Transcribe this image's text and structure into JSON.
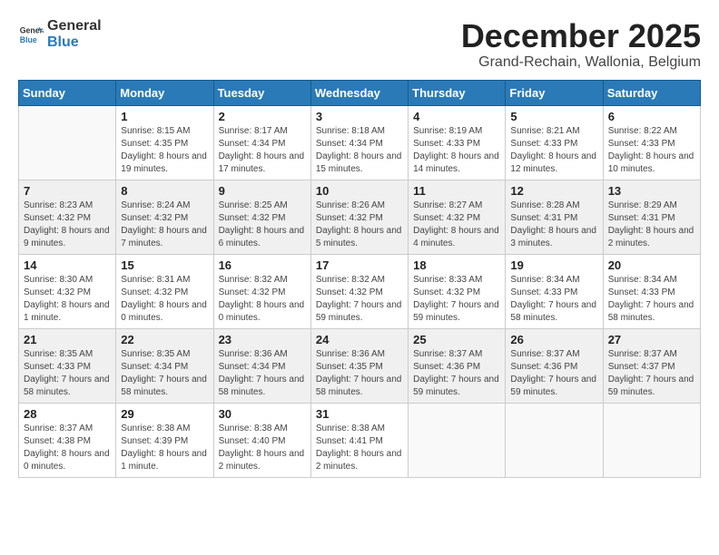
{
  "logo": {
    "text_general": "General",
    "text_blue": "Blue"
  },
  "title": "December 2025",
  "subtitle": "Grand-Rechain, Wallonia, Belgium",
  "days_of_week": [
    "Sunday",
    "Monday",
    "Tuesday",
    "Wednesday",
    "Thursday",
    "Friday",
    "Saturday"
  ],
  "weeks": [
    [
      {
        "day": "",
        "sunrise": "",
        "sunset": "",
        "daylight": "",
        "empty": true
      },
      {
        "day": "1",
        "sunrise": "Sunrise: 8:15 AM",
        "sunset": "Sunset: 4:35 PM",
        "daylight": "Daylight: 8 hours and 19 minutes."
      },
      {
        "day": "2",
        "sunrise": "Sunrise: 8:17 AM",
        "sunset": "Sunset: 4:34 PM",
        "daylight": "Daylight: 8 hours and 17 minutes."
      },
      {
        "day": "3",
        "sunrise": "Sunrise: 8:18 AM",
        "sunset": "Sunset: 4:34 PM",
        "daylight": "Daylight: 8 hours and 15 minutes."
      },
      {
        "day": "4",
        "sunrise": "Sunrise: 8:19 AM",
        "sunset": "Sunset: 4:33 PM",
        "daylight": "Daylight: 8 hours and 14 minutes."
      },
      {
        "day": "5",
        "sunrise": "Sunrise: 8:21 AM",
        "sunset": "Sunset: 4:33 PM",
        "daylight": "Daylight: 8 hours and 12 minutes."
      },
      {
        "day": "6",
        "sunrise": "Sunrise: 8:22 AM",
        "sunset": "Sunset: 4:33 PM",
        "daylight": "Daylight: 8 hours and 10 minutes."
      }
    ],
    [
      {
        "day": "7",
        "sunrise": "Sunrise: 8:23 AM",
        "sunset": "Sunset: 4:32 PM",
        "daylight": "Daylight: 8 hours and 9 minutes."
      },
      {
        "day": "8",
        "sunrise": "Sunrise: 8:24 AM",
        "sunset": "Sunset: 4:32 PM",
        "daylight": "Daylight: 8 hours and 7 minutes."
      },
      {
        "day": "9",
        "sunrise": "Sunrise: 8:25 AM",
        "sunset": "Sunset: 4:32 PM",
        "daylight": "Daylight: 8 hours and 6 minutes."
      },
      {
        "day": "10",
        "sunrise": "Sunrise: 8:26 AM",
        "sunset": "Sunset: 4:32 PM",
        "daylight": "Daylight: 8 hours and 5 minutes."
      },
      {
        "day": "11",
        "sunrise": "Sunrise: 8:27 AM",
        "sunset": "Sunset: 4:32 PM",
        "daylight": "Daylight: 8 hours and 4 minutes."
      },
      {
        "day": "12",
        "sunrise": "Sunrise: 8:28 AM",
        "sunset": "Sunset: 4:31 PM",
        "daylight": "Daylight: 8 hours and 3 minutes."
      },
      {
        "day": "13",
        "sunrise": "Sunrise: 8:29 AM",
        "sunset": "Sunset: 4:31 PM",
        "daylight": "Daylight: 8 hours and 2 minutes."
      }
    ],
    [
      {
        "day": "14",
        "sunrise": "Sunrise: 8:30 AM",
        "sunset": "Sunset: 4:32 PM",
        "daylight": "Daylight: 8 hours and 1 minute."
      },
      {
        "day": "15",
        "sunrise": "Sunrise: 8:31 AM",
        "sunset": "Sunset: 4:32 PM",
        "daylight": "Daylight: 8 hours and 0 minutes."
      },
      {
        "day": "16",
        "sunrise": "Sunrise: 8:32 AM",
        "sunset": "Sunset: 4:32 PM",
        "daylight": "Daylight: 8 hours and 0 minutes."
      },
      {
        "day": "17",
        "sunrise": "Sunrise: 8:32 AM",
        "sunset": "Sunset: 4:32 PM",
        "daylight": "Daylight: 7 hours and 59 minutes."
      },
      {
        "day": "18",
        "sunrise": "Sunrise: 8:33 AM",
        "sunset": "Sunset: 4:32 PM",
        "daylight": "Daylight: 7 hours and 59 minutes."
      },
      {
        "day": "19",
        "sunrise": "Sunrise: 8:34 AM",
        "sunset": "Sunset: 4:33 PM",
        "daylight": "Daylight: 7 hours and 58 minutes."
      },
      {
        "day": "20",
        "sunrise": "Sunrise: 8:34 AM",
        "sunset": "Sunset: 4:33 PM",
        "daylight": "Daylight: 7 hours and 58 minutes."
      }
    ],
    [
      {
        "day": "21",
        "sunrise": "Sunrise: 8:35 AM",
        "sunset": "Sunset: 4:33 PM",
        "daylight": "Daylight: 7 hours and 58 minutes."
      },
      {
        "day": "22",
        "sunrise": "Sunrise: 8:35 AM",
        "sunset": "Sunset: 4:34 PM",
        "daylight": "Daylight: 7 hours and 58 minutes."
      },
      {
        "day": "23",
        "sunrise": "Sunrise: 8:36 AM",
        "sunset": "Sunset: 4:34 PM",
        "daylight": "Daylight: 7 hours and 58 minutes."
      },
      {
        "day": "24",
        "sunrise": "Sunrise: 8:36 AM",
        "sunset": "Sunset: 4:35 PM",
        "daylight": "Daylight: 7 hours and 58 minutes."
      },
      {
        "day": "25",
        "sunrise": "Sunrise: 8:37 AM",
        "sunset": "Sunset: 4:36 PM",
        "daylight": "Daylight: 7 hours and 59 minutes."
      },
      {
        "day": "26",
        "sunrise": "Sunrise: 8:37 AM",
        "sunset": "Sunset: 4:36 PM",
        "daylight": "Daylight: 7 hours and 59 minutes."
      },
      {
        "day": "27",
        "sunrise": "Sunrise: 8:37 AM",
        "sunset": "Sunset: 4:37 PM",
        "daylight": "Daylight: 7 hours and 59 minutes."
      }
    ],
    [
      {
        "day": "28",
        "sunrise": "Sunrise: 8:37 AM",
        "sunset": "Sunset: 4:38 PM",
        "daylight": "Daylight: 8 hours and 0 minutes."
      },
      {
        "day": "29",
        "sunrise": "Sunrise: 8:38 AM",
        "sunset": "Sunset: 4:39 PM",
        "daylight": "Daylight: 8 hours and 1 minute."
      },
      {
        "day": "30",
        "sunrise": "Sunrise: 8:38 AM",
        "sunset": "Sunset: 4:40 PM",
        "daylight": "Daylight: 8 hours and 2 minutes."
      },
      {
        "day": "31",
        "sunrise": "Sunrise: 8:38 AM",
        "sunset": "Sunset: 4:41 PM",
        "daylight": "Daylight: 8 hours and 2 minutes."
      },
      {
        "day": "",
        "sunrise": "",
        "sunset": "",
        "daylight": "",
        "empty": true
      },
      {
        "day": "",
        "sunrise": "",
        "sunset": "",
        "daylight": "",
        "empty": true
      },
      {
        "day": "",
        "sunrise": "",
        "sunset": "",
        "daylight": "",
        "empty": true
      }
    ]
  ]
}
